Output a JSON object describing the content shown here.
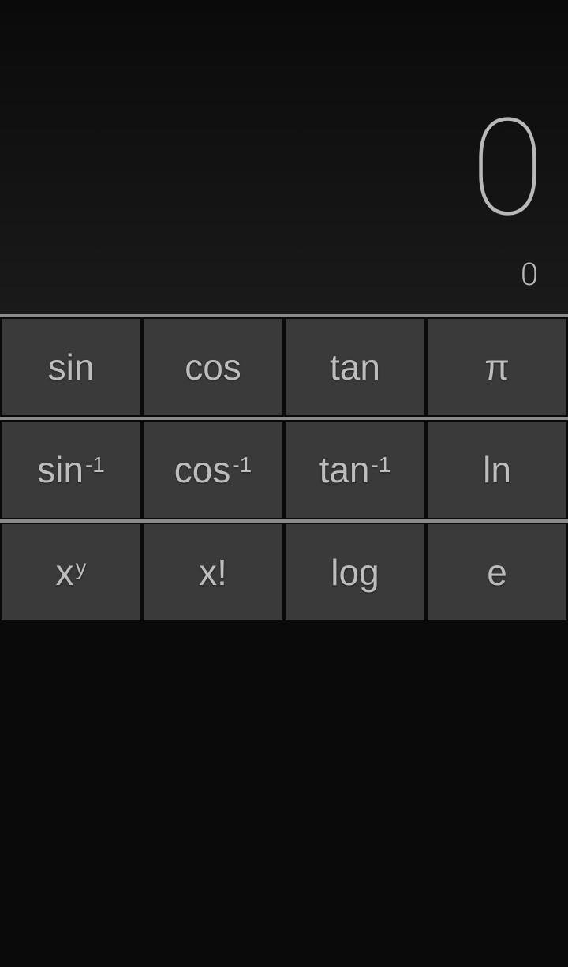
{
  "display": {
    "primary": "0",
    "secondary": "0"
  },
  "keypad": {
    "rows": [
      {
        "keys": [
          {
            "name": "sin-button",
            "label": "sin",
            "sup": ""
          },
          {
            "name": "cos-button",
            "label": "cos",
            "sup": ""
          },
          {
            "name": "tan-button",
            "label": "tan",
            "sup": ""
          },
          {
            "name": "pi-button",
            "label": "π",
            "sup": ""
          }
        ]
      },
      {
        "keys": [
          {
            "name": "asin-button",
            "label": "sin",
            "sup": "-1"
          },
          {
            "name": "acos-button",
            "label": "cos",
            "sup": "-1"
          },
          {
            "name": "atan-button",
            "label": "tan",
            "sup": "-1"
          },
          {
            "name": "ln-button",
            "label": "ln",
            "sup": ""
          }
        ]
      },
      {
        "keys": [
          {
            "name": "power-button",
            "label": "x",
            "sup": "y"
          },
          {
            "name": "factorial-button",
            "label": "x!",
            "sup": ""
          },
          {
            "name": "log-button",
            "label": "log",
            "sup": ""
          },
          {
            "name": "e-button",
            "label": "e",
            "sup": ""
          }
        ]
      }
    ]
  }
}
